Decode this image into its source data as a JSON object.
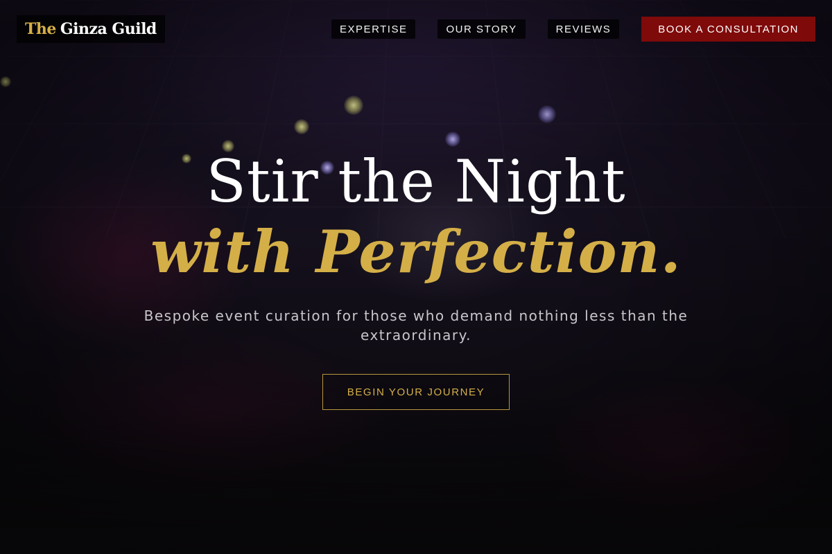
{
  "brand": {
    "logo_accent": "The",
    "logo_text": "Ginza Guild"
  },
  "nav": {
    "links": [
      {
        "label": "EXPERTISE"
      },
      {
        "label": "OUR STORY"
      },
      {
        "label": "REVIEWS"
      }
    ],
    "cta_label": "BOOK A CONSULTATION"
  },
  "hero": {
    "headline_line1": "Stir the Night",
    "headline_line2": "with Perfection.",
    "subtitle": "Bespoke event curation for those who demand nothing less than the extraordinary.",
    "cta_label": "BEGIN YOUR JOURNEY"
  },
  "colors": {
    "accent_gold": "#d4af48",
    "cta_red": "#7f0a0a",
    "background_dark": "#0a080c"
  }
}
